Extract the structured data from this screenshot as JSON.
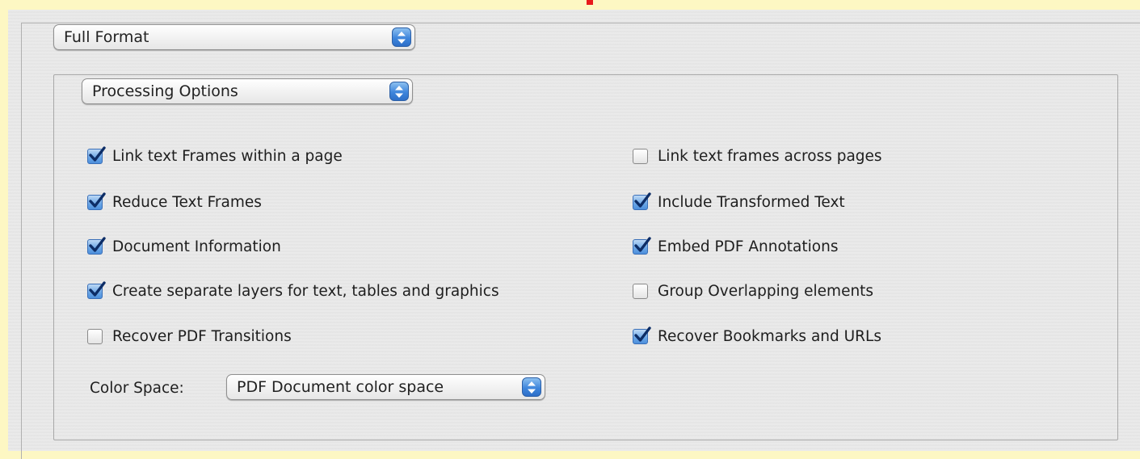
{
  "format_select": {
    "value": "Full Format"
  },
  "section_select": {
    "value": "Processing Options"
  },
  "options_left": [
    {
      "label": "Link text Frames within a page",
      "checked": true
    },
    {
      "label": "Reduce Text Frames",
      "checked": true
    },
    {
      "label": "Document Information",
      "checked": true
    },
    {
      "label": "Create separate layers for text, tables and graphics",
      "checked": true
    },
    {
      "label": "Recover PDF Transitions",
      "checked": false
    }
  ],
  "options_right": [
    {
      "label": "Link text frames across pages",
      "checked": false
    },
    {
      "label": "Include Transformed Text",
      "checked": true
    },
    {
      "label": "Embed PDF Annotations",
      "checked": true
    },
    {
      "label": "Group Overlapping elements",
      "checked": false
    },
    {
      "label": "Recover Bookmarks and URLs",
      "checked": true
    }
  ],
  "color_space": {
    "label": "Color Space:",
    "value": "PDF Document color space"
  },
  "colors": {
    "page_background": "#fdf7c3",
    "panel_background": "#e9e9e9",
    "accent_blue": "#3f86dc",
    "marker_red": "#e8191c"
  },
  "icons": {
    "popup_arrows": "up-down-arrows-icon",
    "checkmark": "checkmark-icon"
  }
}
